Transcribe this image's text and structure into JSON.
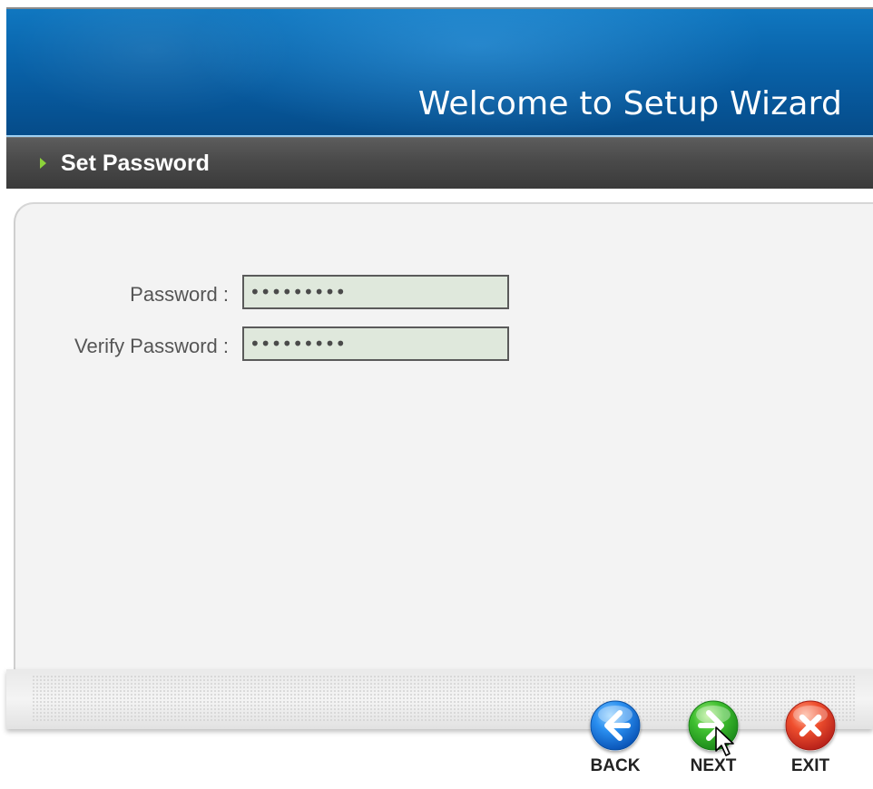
{
  "header": {
    "title": "Welcome to Setup Wizard"
  },
  "section": {
    "title": "Set Password",
    "arrow_icon": "triangle-right-icon"
  },
  "form": {
    "password": {
      "label": "Password :",
      "value": "•••••••••"
    },
    "verify_password": {
      "label": "Verify Password :",
      "value": "•••••••••"
    }
  },
  "nav": {
    "back": {
      "label": "BACK",
      "icon": "arrow-left-icon",
      "color": "#1e7fe0"
    },
    "next": {
      "label": "NEXT",
      "icon": "arrow-right-icon",
      "color": "#36b12e"
    },
    "exit": {
      "label": "EXIT",
      "icon": "close-icon",
      "color": "#e2432a"
    }
  },
  "colors": {
    "header_blue": "#0a66ad",
    "section_bar": "#4a4a4a",
    "accent_green": "#8cd23a",
    "input_bg": "#dfe8dc"
  }
}
